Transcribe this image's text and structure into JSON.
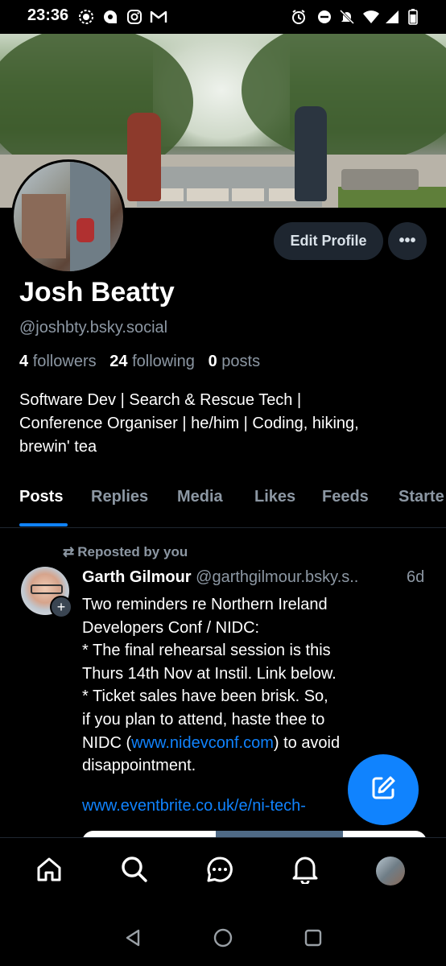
{
  "status_bar": {
    "time": "23:36",
    "left_icons": [
      "signal-messenger-icon",
      "chat-bubble-icon",
      "instagram-icon",
      "gmail-icon"
    ],
    "right_icons": [
      "alarm-icon",
      "do-not-disturb-icon",
      "bell-off-icon",
      "wifi-icon",
      "cellular-signal-icon",
      "battery-icon"
    ]
  },
  "profile": {
    "display_name": "Josh Beatty",
    "handle": "@joshbty.bsky.social",
    "followers_count": "4",
    "followers_label": "followers",
    "following_count": "24",
    "following_label": "following",
    "posts_count": "0",
    "posts_label": "posts",
    "bio_line1": "Software Dev | Search & Rescue Tech |",
    "bio_line2": "Conference Organiser | he/him | Coding, hiking,",
    "bio_line3": "brewin' tea",
    "edit_profile_label": "Edit Profile",
    "more_label": "•••"
  },
  "tabs": [
    {
      "label": "Posts",
      "active": true
    },
    {
      "label": "Replies",
      "active": false
    },
    {
      "label": "Media",
      "active": false
    },
    {
      "label": "Likes",
      "active": false
    },
    {
      "label": "Feeds",
      "active": false
    },
    {
      "label": "Starte",
      "active": false
    }
  ],
  "post": {
    "repost_label": "Reposted by you",
    "author": "Garth Gilmour",
    "author_handle": "@garthgilmour.bsky.s..",
    "time": "6d",
    "line1": "Two reminders re Northern Ireland",
    "line2": "Developers Conf /  NIDC:",
    "line3": "* The final rehearsal session is this",
    "line4": "Thurs 14th Nov at Instil. Link below.",
    "line5": "* Ticket sales have been brisk. So,",
    "line6": "if you plan to attend, haste thee to",
    "line7_pre": "NIDC (",
    "line7_link": "www.nidevconf.com",
    "line7_post": ") to avoid",
    "line8": "disappointment.",
    "link_text": "www.eventbrite.co.uk/e/ni-tech-"
  },
  "bottom_nav": [
    "home-icon",
    "search-icon",
    "chat-icon",
    "notifications-icon",
    "profile-avatar"
  ],
  "colors": {
    "accent": "#1083fe",
    "muted_text": "#8c97a3",
    "button_bg": "#1e2630",
    "background": "#000000"
  }
}
